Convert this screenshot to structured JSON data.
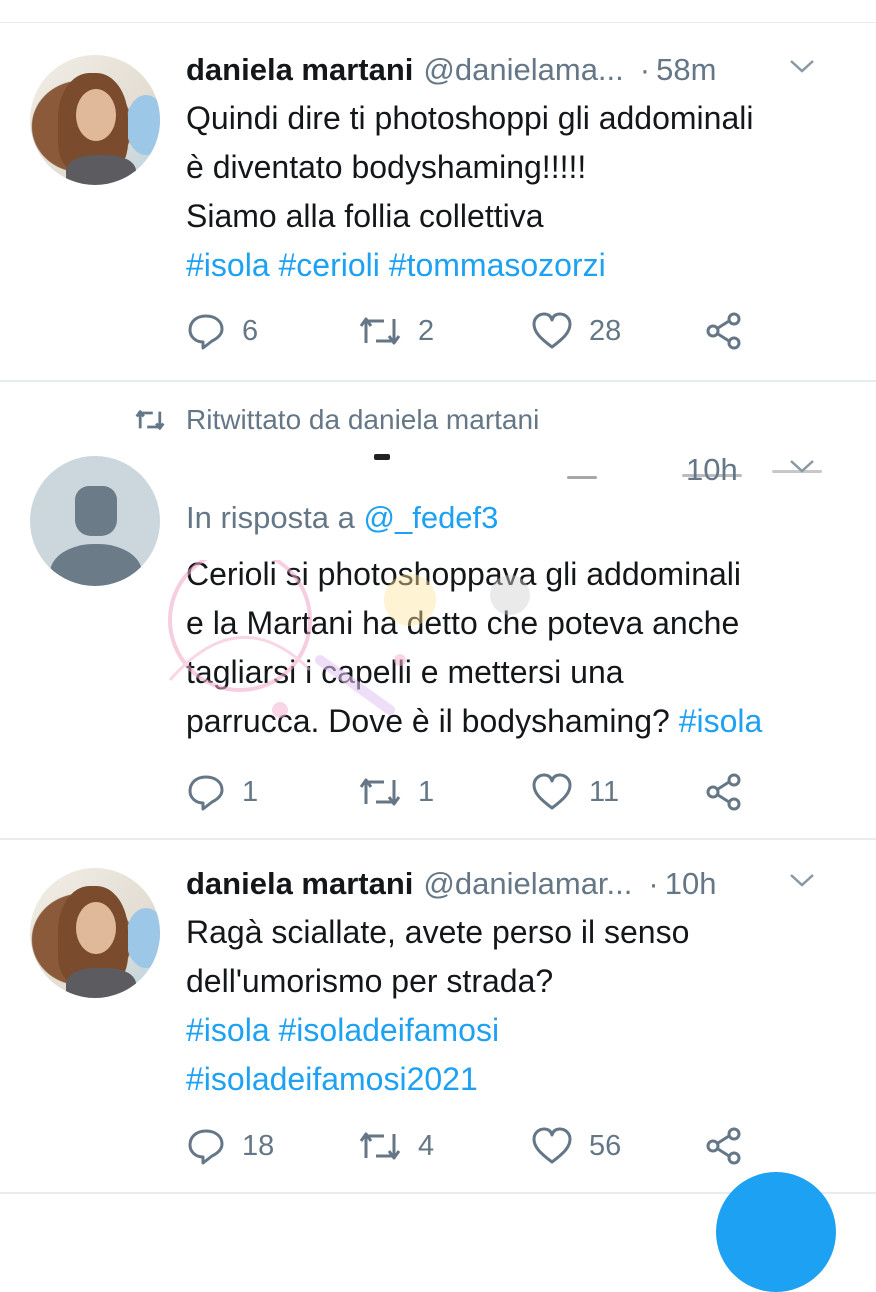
{
  "tweets": [
    {
      "name": "daniela martani",
      "handle": "@danielama...",
      "time": "58m",
      "lines": [
        "Quindi dire ti photoshoppi gli addominali",
        "è diventato bodyshaming!!!!!",
        "Siamo alla follia collettiva"
      ],
      "hashtags": [
        "#isola #cerioli #tommasozorzi"
      ],
      "replies": "6",
      "retweets": "2",
      "likes": "28"
    },
    {
      "retweeted_by": "Ritwittato da daniela martani",
      "time": "10h",
      "reply_to_label": "In risposta a",
      "reply_to_mention": "@_fedef3",
      "lines": [
        "Cerioli si photoshoppava gli addominali",
        "e la Martani ha detto che poteva anche",
        "tagliarsi i capelli e mettersi una"
      ],
      "last_line_text": "parrucca. Dove è il bodyshaming?",
      "last_line_hashtag": "#isola",
      "replies": "1",
      "retweets": "1",
      "likes": "11"
    },
    {
      "name": "daniela martani",
      "handle": "@danielamar...",
      "time": "10h",
      "lines": [
        "Ragà sciallate, avete perso il senso",
        "dell'umorismo per strada?"
      ],
      "hashtags": [
        "#isola #isoladeifamosi",
        "#isoladeifamosi2021"
      ],
      "replies": "18",
      "retweets": "4",
      "likes": "56"
    }
  ],
  "colors": {
    "link": "#1da1f2",
    "secondary_text": "#657786",
    "primary_text": "#14171a",
    "divider": "#e6ecf0"
  },
  "icons": [
    "reply-icon",
    "retweet-icon",
    "like-icon",
    "share-icon",
    "chevron-down-icon"
  ]
}
